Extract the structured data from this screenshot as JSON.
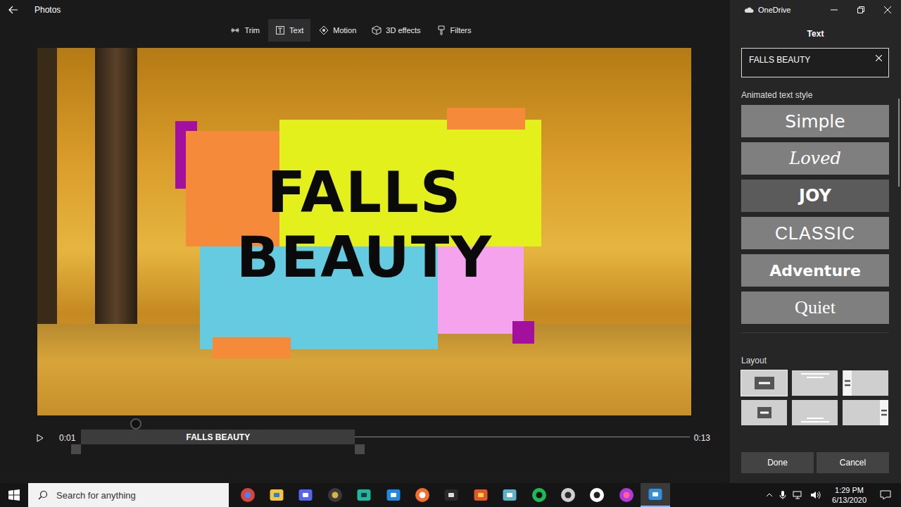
{
  "window": {
    "title": "Photos"
  },
  "toolbar": [
    {
      "label": "Trim",
      "selected": false
    },
    {
      "label": "Text",
      "selected": true
    },
    {
      "label": "Motion",
      "selected": false
    },
    {
      "label": "3D effects",
      "selected": false
    },
    {
      "label": "Filters",
      "selected": false
    }
  ],
  "preview": {
    "timeline": {
      "current": "0:01",
      "duration": "0:13",
      "playhead": {
        "level": 0.09
      },
      "clip": {
        "label": "FALLS BEAUTY",
        "level": 0.45
      }
    }
  },
  "panel": {
    "app": "OneDrive",
    "title": "Text",
    "text_field": {
      "value": "FALLS BEAUTY"
    },
    "styles_label": "Animated text style",
    "styles": [
      {
        "label": "Simple",
        "kind": "simple",
        "selected": false
      },
      {
        "label": "Loved",
        "kind": "script",
        "selected": false
      },
      {
        "label": "JOY",
        "kind": "bold",
        "selected": true
      },
      {
        "label": "CLASSIC",
        "kind": "thin",
        "selected": false
      },
      {
        "label": "Adventure",
        "kind": "heavy",
        "selected": false
      },
      {
        "label": "Quiet",
        "kind": "serif",
        "selected": false
      }
    ],
    "layout_label": "Layout",
    "layouts": [
      {
        "kind": "center",
        "selected": true
      },
      {
        "kind": "top",
        "selected": false
      },
      {
        "kind": "left",
        "selected": false
      },
      {
        "kind": "middle",
        "selected": false
      },
      {
        "kind": "bottom",
        "selected": false
      },
      {
        "kind": "right",
        "selected": false
      }
    ],
    "buttons": [
      {
        "label": "Done"
      },
      {
        "label": "Cancel"
      }
    ]
  },
  "taskbar": {
    "search": {
      "placeholder": "Search for anything"
    },
    "apps": [
      {
        "selected": false
      },
      {
        "selected": false
      },
      {
        "selected": false
      },
      {
        "selected": false
      },
      {
        "selected": false
      },
      {
        "selected": false
      },
      {
        "selected": false
      },
      {
        "selected": false
      },
      {
        "selected": false
      },
      {
        "selected": false
      },
      {
        "selected": false
      },
      {
        "selected": false
      },
      {
        "selected": false
      },
      {
        "selected": false
      },
      {
        "selected": true
      }
    ],
    "clock": {
      "time": "1:29 PM",
      "date": "6/13/2020"
    }
  }
}
